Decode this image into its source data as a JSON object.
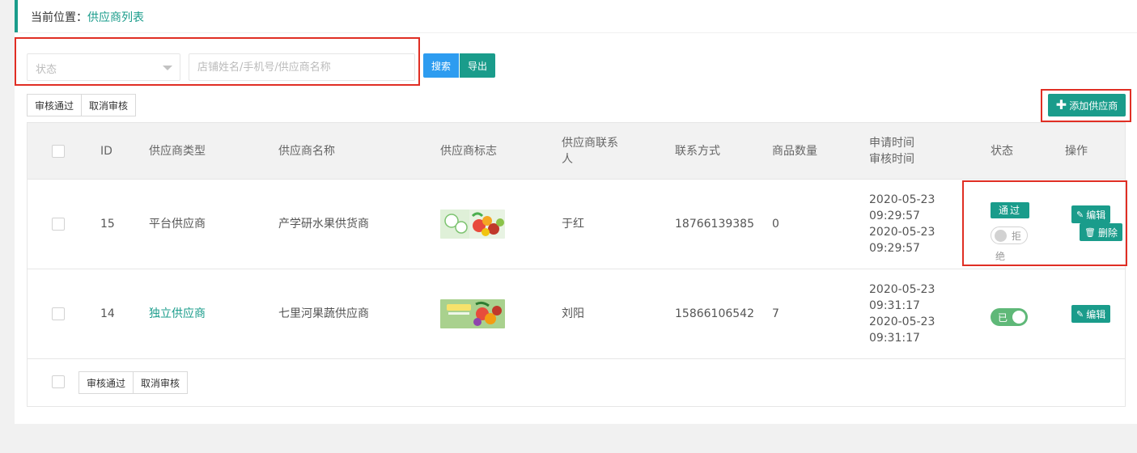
{
  "breadcrumb": {
    "prefix": "当前位置：",
    "current": "供应商列表"
  },
  "filters": {
    "status_placeholder": "状态",
    "search_placeholder": "店铺姓名/手机号/供应商名称",
    "search_label": "搜索",
    "export_label": "导出"
  },
  "toolbar": {
    "approve_label": "审核通过",
    "cancel_label": "取消审核",
    "add_label": "添加供应商"
  },
  "table": {
    "headers": {
      "id": "ID",
      "type": "供应商类型",
      "name": "供应商名称",
      "logo": "供应商标志",
      "contact_line1": "供应商联系",
      "contact_line2": "人",
      "phone": "联系方式",
      "goods": "商品数量",
      "time_line1": "申请时间",
      "time_line2": "审核时间",
      "status": "状态",
      "ops": "操作"
    },
    "rows": [
      {
        "id": "15",
        "type": "平台供应商",
        "name": "产学研水果供货商",
        "contact": "于红",
        "phone": "18766139385",
        "goods": "0",
        "apply_date": "2020-05-23",
        "apply_time": "09:29:57",
        "audit_date": "2020-05-23",
        "audit_time": "09:29:57",
        "pass_label": "通过",
        "reject_label_1": "拒",
        "reject_label_2": "绝",
        "edit_label": "编辑",
        "delete_label": "删除"
      },
      {
        "id": "14",
        "type": "独立供应商",
        "name": "七里河果蔬供应商",
        "contact": "刘阳",
        "phone": "15866106542",
        "goods": "7",
        "apply_date": "2020-05-23",
        "apply_time": "09:31:17",
        "audit_date": "2020-05-23",
        "audit_time": "09:31:17",
        "switch_label": "已",
        "edit_label": "编辑"
      }
    ]
  },
  "footer": {
    "approve_label": "审核通过",
    "cancel_label": "取消审核"
  },
  "colors": {
    "accent": "#1a9c8b",
    "search_blue": "#2d9cf0",
    "switch_on": "#5fb878",
    "highlight_red": "#e02e24"
  },
  "icons": {
    "add": "plus-icon",
    "edit": "pencil-icon",
    "delete": "trash-icon",
    "select": "caret-down-icon"
  }
}
